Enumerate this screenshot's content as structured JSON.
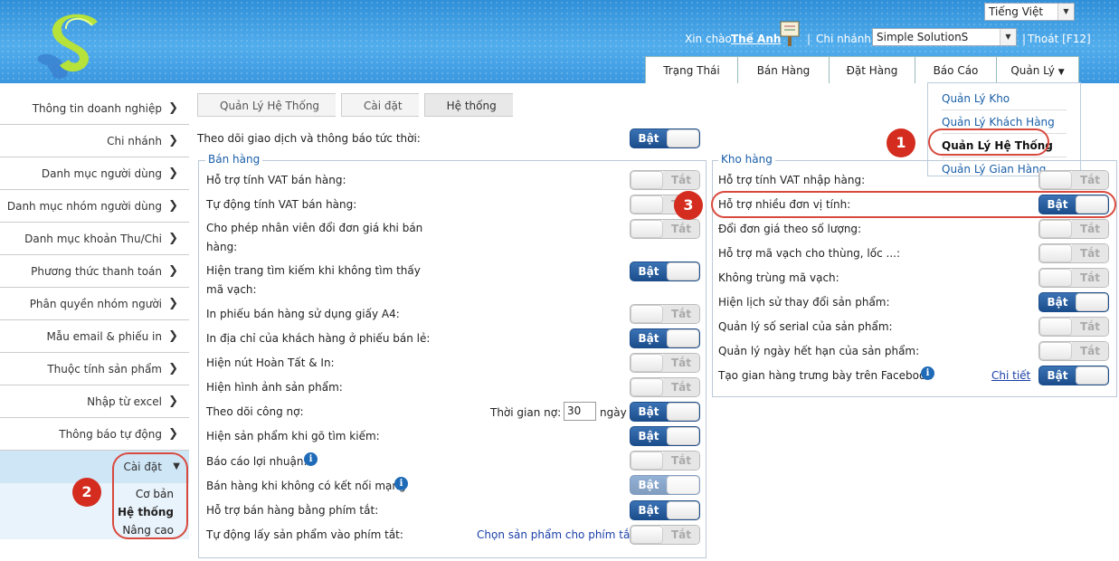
{
  "header": {
    "language": "Tiếng Việt",
    "greeting_prefix": "Xin chào",
    "username": "Thế Anh",
    "branch_label": "Chi nhánh:",
    "branch_value": "Simple SolutionS",
    "logout": "Thoát [F12]",
    "separator": "|"
  },
  "topnav": [
    "Trạng Thái",
    "Bán Hàng",
    "Đặt Hàng",
    "Báo Cáo",
    "Quản Lý"
  ],
  "dropdown": [
    "Quản Lý Kho",
    "Quản Lý Khách Hàng",
    "Quản Lý Hệ Thống",
    "Quản Lý Gian Hàng"
  ],
  "sidebar": {
    "items": [
      "Thông tin doanh nghiệp",
      "Chi nhánh",
      "Danh mục người dùng",
      "Danh mục nhóm người dùng",
      "Danh mục khoản Thu/Chi",
      "Phương thức thanh toán",
      "Phân quyền nhóm người dùng",
      "Mẫu email & phiếu in",
      "Thuộc tính sản phẩm",
      "Nhập từ excel",
      "Thông báo tự động"
    ],
    "active": "Cài đặt",
    "sub": [
      "Cơ bản",
      "Hệ thống",
      "Nâng cao"
    ]
  },
  "breadcrumb": [
    "Quản Lý Hệ Thống",
    "Cài đặt",
    "Hệ thống"
  ],
  "annotations": [
    "1",
    "2",
    "3"
  ],
  "toggle_on": "Bật",
  "toggle_off": "Tắt",
  "realtime_label": "Theo dõi giao dịch và thông báo tức thời:",
  "sales": {
    "title": "Bán hàng",
    "rows": [
      "Hỗ trợ tính VAT bán hàng:",
      "Tự động tính VAT bán hàng:",
      "Cho phép nhân viên đổi đơn giá khi bán hàng:",
      "Hiện trang tìm kiếm khi không tìm thấy mã vạch:",
      "In phiếu bán hàng sử dụng giấy A4:",
      "In địa chỉ của khách hàng ở phiếu bán lẻ:",
      "Hiện nút Hoàn Tất & In:",
      "Hiện hình ảnh sản phẩm:",
      "Theo dõi công nợ:",
      "Hiện sản phẩm khi gõ tìm kiếm:",
      "Báo cáo lợi nhuận:",
      "Bán hàng khi không có kết nối mạng",
      "Hỗ trợ bán hàng bằng phím tắt:",
      "Tự động lấy sản phẩm vào phím tắt:"
    ],
    "debt_time_label": "Thời gian nợ:",
    "debt_time_value": "30",
    "debt_time_unit": "ngày",
    "shortcut_link": "Chọn sản phẩm cho phím tắt"
  },
  "warehouse": {
    "title": "Kho hàng",
    "rows": [
      "Hỗ trợ tính VAT nhập hàng:",
      "Hỗ trợ nhiều đơn vị tính:",
      "Đổi đơn giá theo số lượng:",
      "Hỗ trợ mã vạch cho thùng, lốc ...:",
      "Không trùng mã vạch:",
      "Hiện lịch sử thay đổi sản phẩm:",
      "Quản lý số serial của sản phẩm:",
      "Quản lý ngày hết hạn của sản phẩm:",
      "Tạo gian hàng trưng bày trên Facebook"
    ],
    "detail_link": "Chi tiết"
  },
  "icons": [
    "logo-icon",
    "billboard-icon",
    "chevron-right-icon",
    "chevron-down-icon",
    "info-icon"
  ],
  "colors": {
    "header": "#3a97df",
    "toggle_on": "#1b4d8c",
    "annotation": "#d42d1f",
    "link": "#1a5fa8"
  }
}
